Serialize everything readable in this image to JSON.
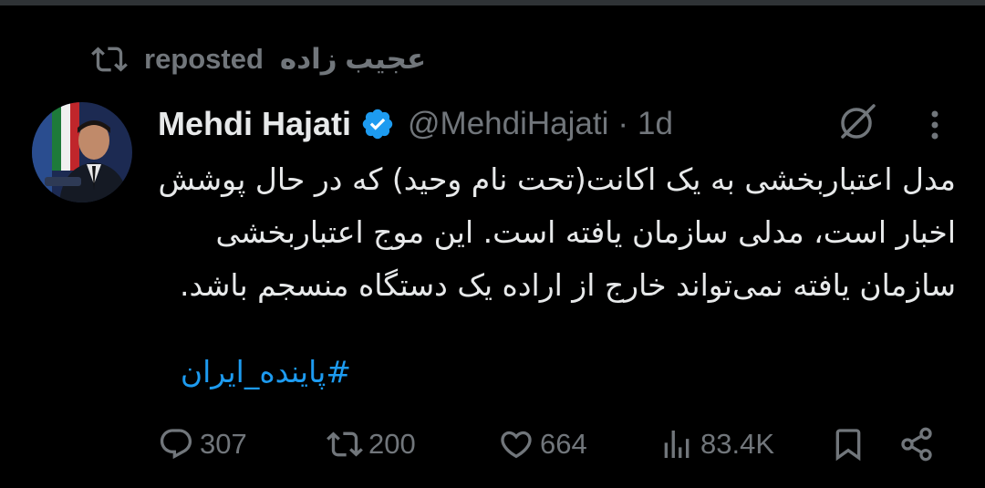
{
  "repost": {
    "reposter": "عجیب زاده",
    "label": "reposted"
  },
  "tweet": {
    "author_name": "Mehdi Hajati",
    "handle": "@MehdiHajati",
    "separator": "·",
    "time": "1d",
    "text": "مدل اعتباربخشی به یک اکانت(تحت نام وحید) که در حال پوشش اخبار است، مدلی سازمان یافته است. این موج اعتباربخشی سازمان یافته نمی‌تواند خارج از اراده یک دستگاه منسجم باشد.",
    "hashtag": "#پاینده_ایران"
  },
  "actions": {
    "replies": "307",
    "reposts": "200",
    "likes": "664",
    "views": "83.4K"
  },
  "icons": {
    "repost": "repost-icon",
    "verified": "verified-badge-icon",
    "grok": "grok-icon",
    "more": "more-icon",
    "reply": "reply-icon",
    "like": "heart-icon",
    "views": "views-icon",
    "bookmark": "bookmark-icon",
    "share": "share-icon"
  },
  "colors": {
    "background": "#000000",
    "text": "#e7e9ea",
    "muted": "#71767b",
    "accent": "#1d9bf0"
  }
}
